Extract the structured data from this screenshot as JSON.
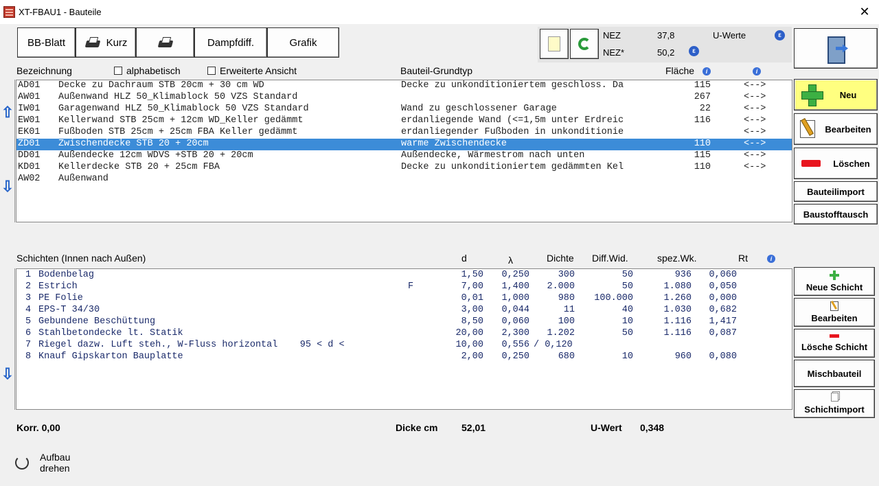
{
  "window": {
    "title": "XT-FBAU1 - Bauteile",
    "close_glyph": "✕"
  },
  "toolbar": {
    "bb_blatt": "BB-Blatt",
    "kurz": "Kurz",
    "dampfdiff": "Dampfdiff.",
    "grafik": "Grafik"
  },
  "nez": {
    "nez_label": "NEZ",
    "nez_value": "37,8",
    "uwerte_label": "U-Werte",
    "nez2_label": "NEZ*",
    "nez2_value": "50,2"
  },
  "bauteile": {
    "header": {
      "bezeichnung": "Bezeichnung",
      "alphabetisch": "alphabetisch",
      "erweiterte": "Erweiterte Ansicht",
      "grundtyp": "Bauteil-Grundtyp",
      "flaeche": "Fläche"
    },
    "rows": [
      {
        "code": "AD01",
        "name": "Decke zu Dachraum STB 20cm + 30 cm WD",
        "typ": "Decke zu unkonditioniertem geschloss. Da",
        "flaeche": "115",
        "arrow": "<-->"
      },
      {
        "code": "AW01",
        "name": "Außenwand HLZ 50_Klimablock 50 VZS Standard",
        "typ": "",
        "flaeche": "267",
        "arrow": "<-->"
      },
      {
        "code": "IW01",
        "name": "Garagenwand HLZ 50_Klimablock 50 VZS Standard",
        "typ": "Wand zu geschlossener Garage",
        "flaeche": "22",
        "arrow": "<-->"
      },
      {
        "code": "EW01",
        "name": "Kellerwand STB 25cm + 12cm WD_Keller gedämmt",
        "typ": "erdanliegende Wand (<=1,5m unter Erdreic",
        "flaeche": "116",
        "arrow": "<-->"
      },
      {
        "code": "EK01",
        "name": "Fußboden STB 25cm + 25cm FBA Keller gedämmt",
        "typ": "erdanliegender Fußboden in unkonditionie",
        "flaeche": "",
        "arrow": "<-->"
      },
      {
        "code": "ZD01",
        "name": "Zwischendecke STB 20 + 20cm",
        "typ": "warme Zwischendecke",
        "flaeche": "110",
        "arrow": "<-->"
      },
      {
        "code": "DD01",
        "name": "Außendecke 12cm WDVS +STB 20 + 20cm",
        "typ": "Außendecke, Wärmestrom nach unten",
        "flaeche": "115",
        "arrow": "<-->"
      },
      {
        "code": "KD01",
        "name": "Kellerdecke STB 20 + 25cm FBA",
        "typ": "Decke zu unkonditioniertem gedämmten Kel",
        "flaeche": "110",
        "arrow": "<-->"
      },
      {
        "code": "AW02",
        "name": "Außenwand",
        "typ": "",
        "flaeche": "",
        "arrow": ""
      }
    ]
  },
  "schichten": {
    "header": {
      "title": "Schichten (Innen nach Außen)",
      "d": "d",
      "lambda": "λ",
      "dichte": "Dichte",
      "diff": "Diff.Wid.",
      "spez": "spez.Wk.",
      "rt": "Rt"
    },
    "rows": [
      {
        "nr": "1",
        "name": "Bodenbelag",
        "flag": "",
        "d": "1,50",
        "lambda": "0,250",
        "dichte": "300",
        "diff": "50",
        "spez": "936",
        "rt": "0,060"
      },
      {
        "nr": "2",
        "name": "Estrich",
        "flag": "F",
        "d": "7,00",
        "lambda": "1,400",
        "dichte": "2.000",
        "diff": "50",
        "spez": "1.080",
        "rt": "0,050"
      },
      {
        "nr": "3",
        "name": "PE Folie",
        "flag": "",
        "d": "0,01",
        "lambda": "1,000",
        "dichte": "980",
        "diff": "100.000",
        "spez": "1.260",
        "rt": "0,000"
      },
      {
        "nr": "4",
        "name": "EPS-T 34/30",
        "flag": "",
        "d": "3,00",
        "lambda": "0,044",
        "dichte": "11",
        "diff": "40",
        "spez": "1.030",
        "rt": "0,682"
      },
      {
        "nr": "5",
        "name": "Gebundene Beschüttung",
        "flag": "",
        "d": "8,50",
        "lambda": "0,060",
        "dichte": "100",
        "diff": "10",
        "spez": "1.116",
        "rt": "1,417"
      },
      {
        "nr": "6",
        "name": "Stahlbetondecke lt. Statik",
        "flag": "",
        "d": "20,00",
        "lambda": "2,300",
        "dichte": "1.202",
        "diff": "50",
        "spez": "1.116",
        "rt": "0,087"
      },
      {
        "nr": "7",
        "name": "Riegel dazw. Luft steh., W-Fluss horizontal    95 < d <",
        "flag": "",
        "d": "10,00",
        "lambda": "0,556",
        "dichte": "/ 0,120",
        "diff": "",
        "spez": "",
        "rt": ""
      },
      {
        "nr": "8",
        "name": "Knauf Gipskarton Bauplatte",
        "flag": "",
        "d": "2,00",
        "lambda": "0,250",
        "dichte": "680",
        "diff": "10",
        "spez": "960",
        "rt": "0,080"
      }
    ]
  },
  "footer": {
    "korr": "Korr. 0,00",
    "dicke_label": "Dicke cm",
    "dicke_value": "52,01",
    "uwert_label": "U-Wert",
    "uwert_value": "0,348",
    "autbau_line1": "Aufbau",
    "autbau_line2": "drehen"
  },
  "side_buttons": {
    "neu": "Neu",
    "bearbeiten": "Bearbeiten",
    "loeschen": "Löschen",
    "bauteilimport": "Bauteilimport",
    "baustofftausch": "Baustofftausch",
    "neue_schicht": "Neue Schicht",
    "bearbeiten2": "Bearbeiten",
    "loesche_schicht": "Lösche Schicht",
    "mischbauteil": "Mischbauteil",
    "schichtimport": "Schichtimport"
  },
  "colors": {
    "selection": "#3c8cd8",
    "neu_bg": "#ffff80",
    "row_text": "#222222"
  }
}
